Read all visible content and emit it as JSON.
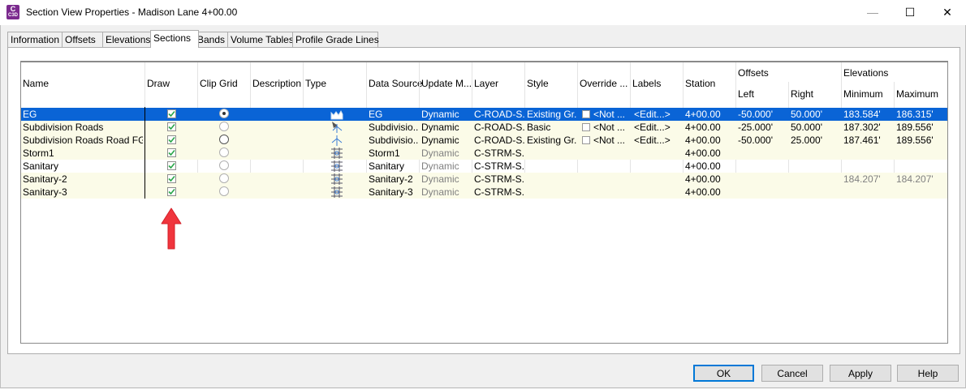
{
  "window": {
    "title": "Section View Properties - Madison Lane 4+00.00",
    "app_icon_letter": "C",
    "app_icon_sub": "C3D",
    "min_glyph": "—",
    "max_glyph": "☐",
    "close_glyph": "✕"
  },
  "tabs": [
    {
      "label": "Information"
    },
    {
      "label": "Offsets"
    },
    {
      "label": "Elevations"
    },
    {
      "label": "Sections"
    },
    {
      "label": "Bands"
    },
    {
      "label": "Volume Tables"
    },
    {
      "label": "Profile Grade Lines"
    }
  ],
  "active_tab": "Sections",
  "columns": {
    "name": "Name",
    "draw": "Draw",
    "clip_grid": "Clip Grid",
    "description": "Description",
    "type": "Type",
    "data_source": "Data Source",
    "update_mode": "Update M...",
    "layer": "Layer",
    "style": "Style",
    "override": "Override ...",
    "labels": "Labels",
    "station": "Station",
    "offsets": "Offsets",
    "left": "Left",
    "right": "Right",
    "elevations": "Elevations",
    "minimum": "Minimum",
    "maximum": "Maximum"
  },
  "rows": [
    {
      "name": "EG",
      "draw": true,
      "clip": "selected",
      "type_icon": "surface-section-icon",
      "source": "EG",
      "update": "Dynamic",
      "layer": "C-ROAD-S...",
      "style": "Existing Gr...",
      "override": "<Not ...",
      "labels": "<Edit...>",
      "station": "4+00.00",
      "left": "-50.000'",
      "right": "50.000'",
      "min": "183.584'",
      "max": "186.315'"
    },
    {
      "name": "Subdivision Roads",
      "draw": true,
      "clip": "empty",
      "type_icon": "corridor-section-icon",
      "source": "Subdivisio...",
      "update": "Dynamic",
      "layer": "C-ROAD-S...",
      "style": "Basic",
      "override": "<Not ...",
      "labels": "<Edit...>",
      "station": "4+00.00",
      "left": "-25.000'",
      "right": "50.000'",
      "min": "187.302'",
      "max": "189.556'"
    },
    {
      "name": "Subdivision Roads Road FG",
      "draw": true,
      "clip": "empty-dark",
      "type_icon": "surface-line-icon",
      "source": "Subdivisio...",
      "update": "Dynamic",
      "layer": "C-ROAD-S...",
      "style": "Existing Gr...",
      "override": "<Not ...",
      "labels": "<Edit...>",
      "station": "4+00.00",
      "left": "-50.000'",
      "right": "25.000'",
      "min": "187.461'",
      "max": "189.556'"
    },
    {
      "name": "Storm1",
      "draw": true,
      "clip": "empty",
      "type_icon": "pipe-network-icon",
      "source": "Storm1",
      "update": "Dynamic",
      "layer": "C-STRM-S...",
      "style": "",
      "override": "",
      "labels": "",
      "station": "4+00.00",
      "left": "",
      "right": "",
      "min": "",
      "max": ""
    },
    {
      "name": "Sanitary",
      "draw": true,
      "clip": "empty",
      "type_icon": "pipe-network-icon",
      "source": "Sanitary",
      "update": "Dynamic",
      "layer": "C-STRM-S...",
      "style": "",
      "override": "",
      "labels": "",
      "station": "4+00.00",
      "left": "",
      "right": "",
      "min": "",
      "max": ""
    },
    {
      "name": "Sanitary-2",
      "draw": true,
      "clip": "empty",
      "type_icon": "pipe-network-icon",
      "source": "Sanitary-2",
      "update": "Dynamic",
      "layer": "C-STRM-S...",
      "style": "",
      "override": "",
      "labels": "",
      "station": "4+00.00",
      "left": "",
      "right": "",
      "min": "184.207'",
      "max": "184.207'"
    },
    {
      "name": "Sanitary-3",
      "draw": true,
      "clip": "empty",
      "type_icon": "pipe-network-icon",
      "source": "Sanitary-3",
      "update": "Dynamic",
      "layer": "C-STRM-S...",
      "style": "",
      "override": "",
      "labels": "",
      "station": "4+00.00",
      "left": "",
      "right": "",
      "min": "",
      "max": ""
    }
  ],
  "buttons": {
    "ok": "OK",
    "cancel": "Cancel",
    "apply": "Apply",
    "help": "Help"
  },
  "colors": {
    "selection": "#0a64d6",
    "annotation_arrow": "#f0353d",
    "alt_row": "#fbfbe8",
    "check": "#2aa64a"
  }
}
